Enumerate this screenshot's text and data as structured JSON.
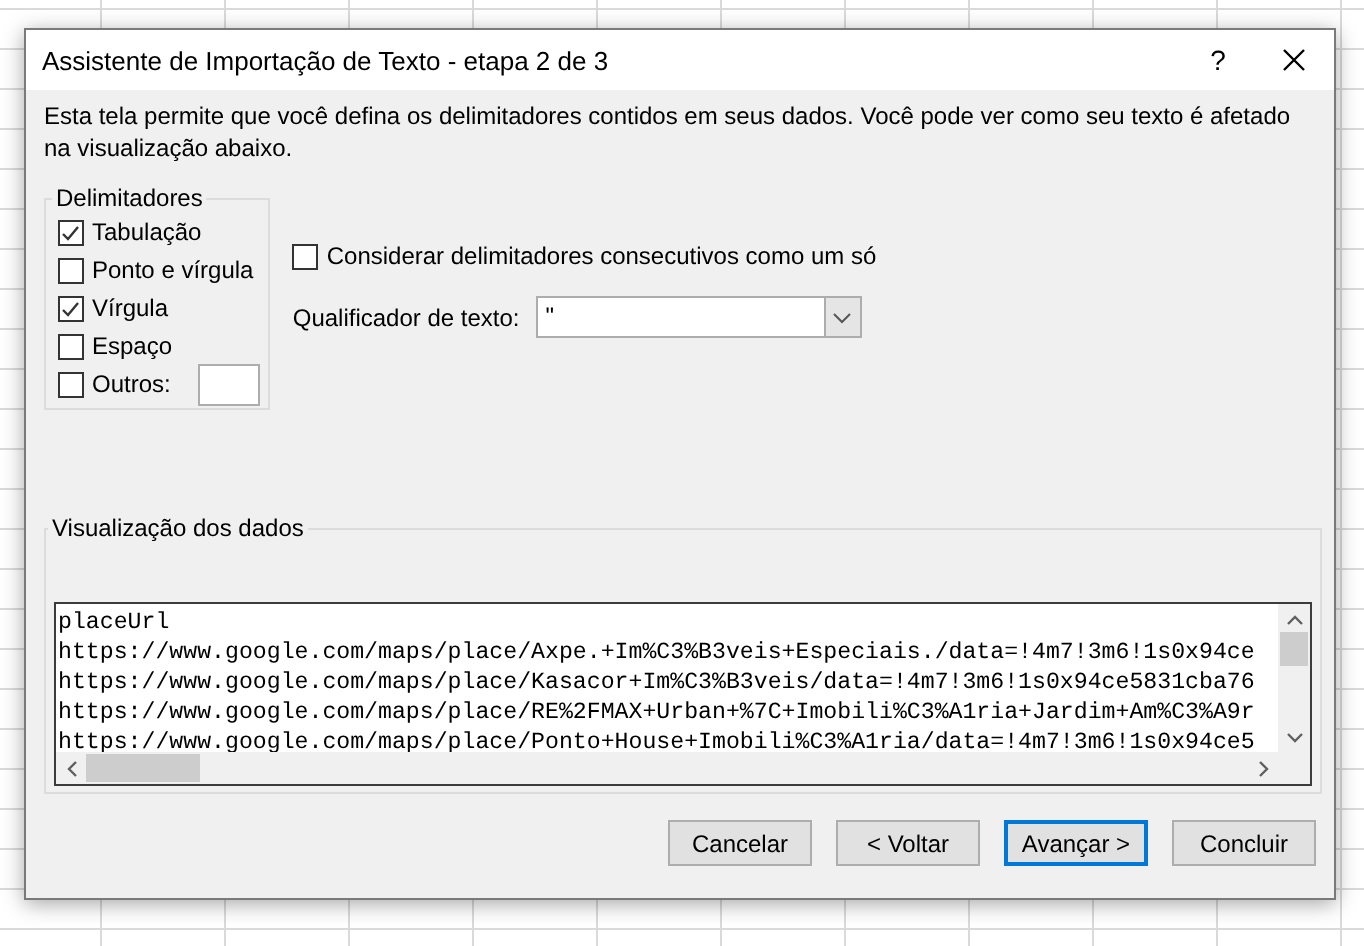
{
  "window": {
    "title": "Assistente de Importação de Texto - etapa 2 de 3",
    "help": "?"
  },
  "description": "Esta tela permite que você defina os delimitadores contidos em seus dados. Você pode ver como seu texto é afetado na visualização abaixo.",
  "delimiters": {
    "title": "Delimitadores",
    "options": [
      {
        "label": "Tabulação",
        "checked": true,
        "kind": "plain"
      },
      {
        "label": "Ponto e vírgula",
        "checked": false,
        "kind": "plain"
      },
      {
        "label": "Vírgula",
        "checked": true,
        "kind": "plain"
      },
      {
        "label": "Espaço",
        "checked": false,
        "kind": "plain"
      },
      {
        "label": "Outros:",
        "checked": false,
        "kind": "with-field"
      }
    ]
  },
  "consecutive": {
    "label": "Considerar delimitadores consecutivos como um só",
    "checked": false
  },
  "text_qualifier": {
    "label": "Qualificador de texto:",
    "value": "\""
  },
  "preview": {
    "title": "Visualização dos dados",
    "lines": [
      "placeUrl",
      "https://www.google.com/maps/place/Axpe.+Im%C3%B3veis+Especiais./data=!4m7!3m6!1s0x94ce",
      "https://www.google.com/maps/place/Kasacor+Im%C3%B3veis/data=!4m7!3m6!1s0x94ce5831cba76",
      "https://www.google.com/maps/place/RE%2FMAX+Urban+%7C+Imobili%C3%A1ria+Jardim+Am%C3%A9r",
      "https://www.google.com/maps/place/Ponto+House+Imobili%C3%A1ria/data=!4m7!3m6!1s0x94ce5"
    ]
  },
  "buttons": [
    {
      "label": "Cancelar",
      "focused": false
    },
    {
      "label": "< Voltar",
      "focused": false
    },
    {
      "label": "Avançar >",
      "focused": true
    },
    {
      "label": "Concluir",
      "focused": false
    }
  ]
}
